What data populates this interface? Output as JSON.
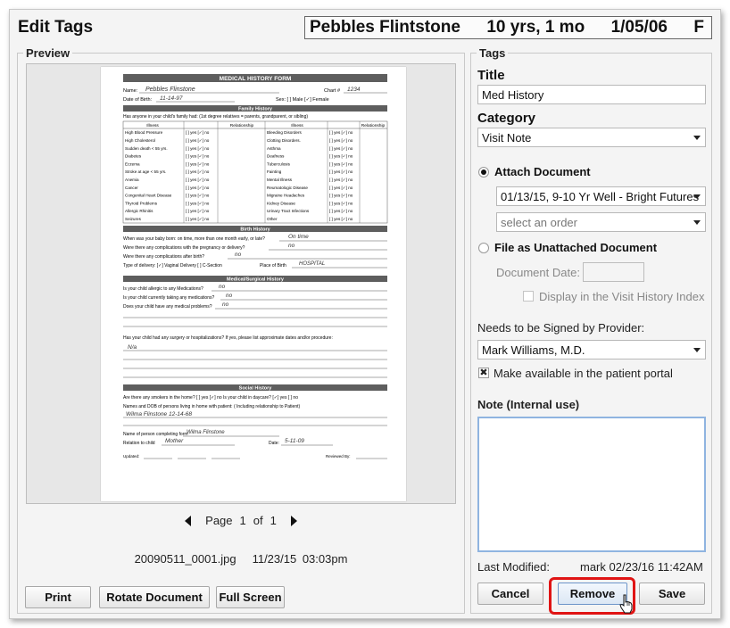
{
  "dialog": {
    "title": "Edit Tags"
  },
  "patient": {
    "name": "Pebbles Flintstone",
    "age": "10 yrs, 1 mo",
    "dob": "1/05/06",
    "sex": "F"
  },
  "preview": {
    "legend": "Preview",
    "pager": {
      "page_word": "Page",
      "current": "1",
      "of_word": "of",
      "total": "1"
    },
    "file_name": "20090511_0001.jpg",
    "file_timestamp": "11/23/15 03:03pm",
    "buttons": {
      "print": "Print",
      "rotate": "Rotate Document",
      "full_screen": "Full Screen"
    },
    "document": {
      "heading": "MEDICAL HISTORY FORM",
      "name_label": "Name:",
      "name_value": "Pebbles Flinstone",
      "chart_label": "Chart #",
      "chart_value": "1234",
      "dob_label": "Date of Birth:",
      "dob_value": "11-14-97",
      "sex_label": "Sex: [  ] Male  [✓] Female",
      "family_heading": "Family History",
      "family_question": "Has anyone in your child's family had: (1st degree relatives = parents, grandparent, or sibling)",
      "col_illness": "Illness",
      "col_relationship": "Relationship",
      "illnesses_left": [
        "High Blood Pressure",
        "High Cholesterol",
        "Sudden death < 55 yrs.",
        "Diabetes",
        "Eczema",
        "Stroke at age < 55 yrs.",
        "Anemia",
        "Cancer",
        "Congenital Heart Disease",
        "Thyroid Problems",
        "Allergic Rhinitis",
        "Seizures"
      ],
      "illnesses_right": [
        "Bleeding Disorders",
        "Clotting Disorders.",
        "Asthma",
        "Deafness",
        "Tuberculosis",
        "Fainting",
        "Mental Illness",
        "Reumatologic Disease",
        "Migraine Headaches",
        "Kidney Disease",
        "Urinary Tract Infections",
        "Other"
      ],
      "yes_no": "[  ] yes  [✓] no",
      "birth_heading": "Birth History",
      "birth_q1": "When was your baby born: on time, more than one month early, or late?",
      "birth_a1": "On time",
      "birth_q2": "Were there any complications with the pregnancy or delivery?",
      "birth_a2": "no",
      "birth_q3": "Were there any complications after birth?",
      "birth_a3": "no",
      "birth_q4": "Type of delivery: [✓] Vaginal Delivery  [  ] C-Section",
      "birth_place_label": "Place of Birth",
      "birth_place_value": "HOSPITAL",
      "medsurg_heading": "Medical/Surgical History",
      "med_q1": "Is your child allergic to any Medications?",
      "med_a1": "no",
      "med_q2": "Is your child currently taking any medications?",
      "med_a2": "no",
      "med_q3": "Does your child have any medical problems?",
      "med_a3": "no",
      "med_q4": "Has your child had any surgery or hospitalizations? If yes, please list approximate dates and/or procedure:",
      "med_a4": "N/a",
      "social_heading": "Social History",
      "social_q1": "Are there any smokers in the home?  [  ] yes   [✓] no    Is your child in daycare?  [✓] yes   [  ] no",
      "social_q2": "Names and DOB of persons living in home with patient: ( Including relationship to Patient)",
      "social_a2": "Wilma Flinstone   12-14-68",
      "completed_by_label": "Name of person completing form",
      "completed_by_value": "Wilma Flinstone",
      "relation_label": "Relation to child",
      "relation_value": "Mother",
      "date_label": "Date:",
      "date_value": "5-11-09",
      "updated_label": "Updated:",
      "reviewed_label": "Reviewed By:"
    }
  },
  "tags": {
    "legend": "Tags",
    "title_label": "Title",
    "title_value": "Med History",
    "category_label": "Category",
    "category_value": "Visit Note",
    "attach_label": "Attach Document",
    "attach_visit_value": "01/13/15, 9-10 Yr Well - Bright Futures",
    "attach_order_placeholder": "select an order",
    "unattached_label": "File as Unattached Document",
    "document_date_label": "Document Date:",
    "document_date_value": "",
    "display_visit_history_label": "Display in the Visit History Index",
    "signer_label": "Needs to be Signed by Provider:",
    "signer_value": "Mark Williams, M.D.",
    "portal_label": "Make available in the patient portal",
    "note_label": "Note (Internal use)",
    "note_value": "",
    "last_modified_label": "Last Modified:",
    "last_modified_value": "mark 02/23/16 11:42AM",
    "buttons": {
      "cancel": "Cancel",
      "remove": "Remove",
      "save": "Save"
    }
  },
  "colors": {
    "highlight": "#e01414",
    "note_focus_border": "#8fb4e0",
    "form_header_fill": "#5e5e5e"
  }
}
